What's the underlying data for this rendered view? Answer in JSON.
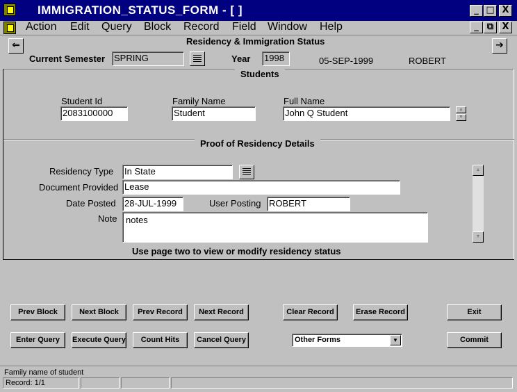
{
  "window": {
    "title": "IMMIGRATION_STATUS_FORM - [ ]",
    "min_glyph": "_",
    "max_glyph": "□",
    "close_glyph": "X",
    "restore_glyph": "⧉"
  },
  "menu": {
    "items": [
      {
        "label": "Action"
      },
      {
        "label": "Edit"
      },
      {
        "label": "Query"
      },
      {
        "label": "Block"
      },
      {
        "label": "Record"
      },
      {
        "label": "Field"
      },
      {
        "label": "Window"
      },
      {
        "label": "Help"
      }
    ]
  },
  "header": {
    "form_title": "Residency & Immigration Status",
    "prev_glyph": "⇐",
    "next_glyph": "➔",
    "semester_label": "Current Semester",
    "semester_value": "SPRING",
    "year_label": "Year",
    "year_value": "1998",
    "date": "05-SEP-1999",
    "user": "ROBERT"
  },
  "students": {
    "section_title": "Students",
    "student_id_label": "Student Id",
    "student_id_value": "2083100000",
    "family_name_label": "Family Name",
    "family_name_value": "Student",
    "full_name_label": "Full Name",
    "full_name_value": "John Q Student"
  },
  "residency": {
    "section_title": "Proof of Residency Details",
    "type_label": "Residency  Type",
    "type_value": "In State",
    "document_label": "Document Provided",
    "document_value": "Lease",
    "date_posted_label": "Date Posted",
    "date_posted_value": "28-JUL-1999",
    "user_posting_label": "User Posting",
    "user_posting_value": "ROBERT",
    "note_label": "Note",
    "note_value": "notes",
    "hint": "Use page two to view or modify residency status"
  },
  "buttons": {
    "prev_block": "Prev Block",
    "next_block": "Next Block",
    "prev_record": "Prev Record",
    "next_record": "Next Record",
    "clear_record": "Clear Record",
    "erase_record": "Erase Record",
    "exit": "Exit",
    "enter_query": "Enter Query",
    "execute_query": "Execute Query",
    "count_hits": "Count Hits",
    "cancel_query": "Cancel Query",
    "other_forms": "Other Forms",
    "commit": "Commit"
  },
  "status": {
    "hint": "Family name of student",
    "record": "Record: 1/1"
  },
  "icons": {
    "app": "forms-app-icon",
    "lov": "list-of-values-icon"
  }
}
